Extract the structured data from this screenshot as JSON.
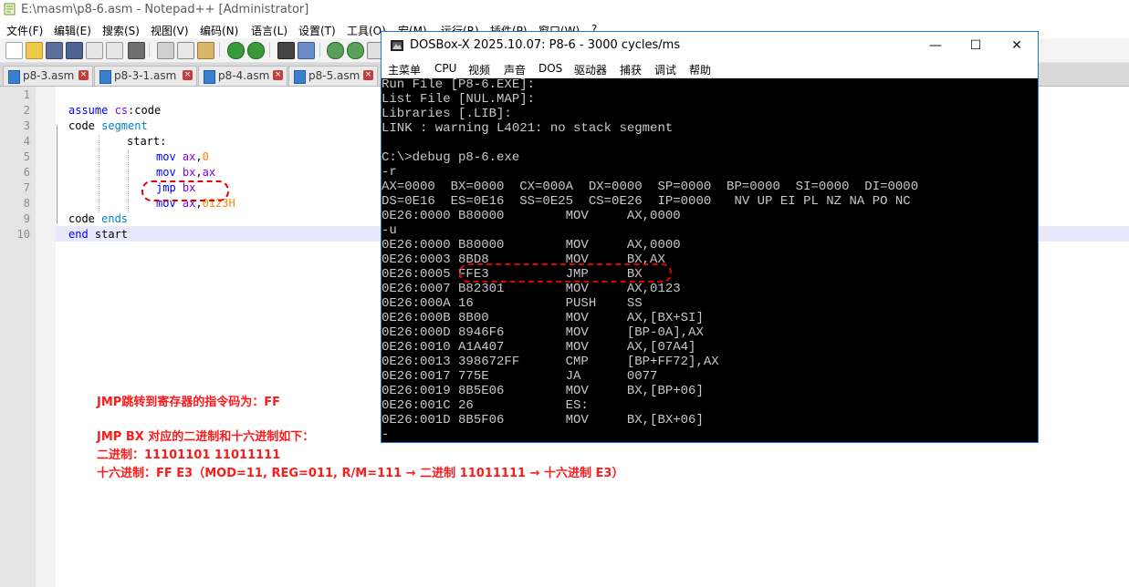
{
  "npp": {
    "title": "E:\\masm\\p8-6.asm - Notepad++ [Administrator]",
    "menu": [
      "文件(F)",
      "编辑(E)",
      "搜索(S)",
      "视图(V)",
      "编码(N)",
      "语言(L)",
      "设置(T)",
      "工具(O)",
      "宏(M)",
      "运行(R)",
      "插件(P)",
      "窗口(W)",
      "?"
    ],
    "tabs": [
      "p8-3.asm",
      "p8-3-1.asm",
      "p8-4.asm",
      "p8-5.asm"
    ],
    "line_numbers": [
      "1",
      "2",
      "3",
      "4",
      "5",
      "6",
      "7",
      "8",
      "9",
      "10"
    ],
    "code": {
      "l2": {
        "kw": "assume",
        "rest1": " ",
        "reg": "cs",
        "rest2": ":code"
      },
      "l3": {
        "a": "code ",
        "kw": "segment"
      },
      "l4": {
        "text": "start:"
      },
      "l5": {
        "kw": "mov",
        "sp": " ",
        "reg": "ax",
        "comma": ",",
        "num": "0"
      },
      "l6": {
        "kw": "mov",
        "sp": " ",
        "reg1": "bx",
        "comma": ",",
        "reg2": "ax"
      },
      "l7": {
        "kw": "jmp",
        "sp": " ",
        "reg": "bx"
      },
      "l8": {
        "kw": "mov",
        "sp": " ",
        "reg": "ax",
        "comma": ",",
        "num": "0123H"
      },
      "l9": {
        "a": "code ",
        "kw": "ends"
      },
      "l10": {
        "kw": "end",
        "rest": " start"
      }
    }
  },
  "notes": [
    "JMP跳转到寄存器的指令码为：FF",
    "JMP BX 对应的二进制和十六进制如下：",
    "二进制：11101101 11011111",
    "十六进制：FF E3（MOD=11, REG=011, R/M=111 → 二进制 11011111 → 十六进制 E3）"
  ],
  "dosbox": {
    "title": "DOSBox-X 2025.10.07: P8-6 - 3000 cycles/ms",
    "menu": [
      "主菜单",
      "CPU",
      "视频",
      "声音",
      "DOS",
      "驱动器",
      "捕获",
      "调试",
      "帮助"
    ],
    "lines": [
      "Run File [P8-6.EXE]:",
      "List File [NUL.MAP]:",
      "Libraries [.LIB]:",
      "LINK : warning L4021: no stack segment",
      "",
      "C:\\>debug p8-6.exe",
      "-r",
      "AX=0000  BX=0000  CX=000A  DX=0000  SP=0000  BP=0000  SI=0000  DI=0000",
      "DS=0E16  ES=0E16  SS=0E25  CS=0E26  IP=0000   NV UP EI PL NZ NA PO NC",
      "0E26:0000 B80000        MOV     AX,0000",
      "-u",
      "0E26:0000 B80000        MOV     AX,0000",
      "0E26:0003 8BD8          MOV     BX,AX",
      "0E26:0005 FFE3          JMP     BX",
      "0E26:0007 B82301        MOV     AX,0123",
      "0E26:000A 16            PUSH    SS",
      "0E26:000B 8B00          MOV     AX,[BX+SI]",
      "0E26:000D 8946F6        MOV     [BP-0A],AX",
      "0E26:0010 A1A407        MOV     AX,[07A4]",
      "0E26:0013 398672FF      CMP     [BP+FF72],AX",
      "0E26:0017 775E          JA      0077",
      "0E26:0019 8B5E06        MOV     BX,[BP+06]",
      "0E26:001C 26            ES:",
      "0E26:001D 8B5F06        MOV     BX,[BX+06]",
      "-"
    ]
  }
}
